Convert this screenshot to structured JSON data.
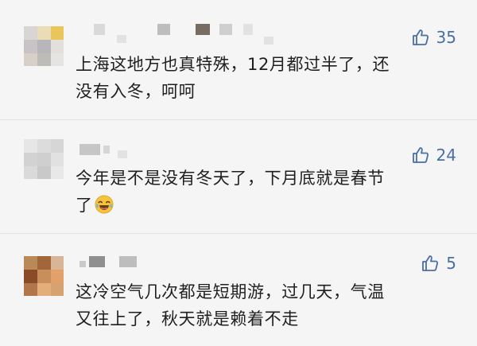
{
  "comments": [
    {
      "likes": "35",
      "text_line1": "上海这地方也真特殊，12月都过半了，还",
      "text_line2": "没有入冬，呵呵"
    },
    {
      "likes": "24",
      "text_line1": "今年是不是没有冬天了，下月底就是春节",
      "text_line2": "了",
      "emoji": "laughing-crying-emoji"
    },
    {
      "likes": "5",
      "text_line1": "这冷空气几次都是短期游，过几天，气温",
      "text_line2": "又往上了，秋天就是赖着不走"
    }
  ],
  "icons": {
    "like": "thumbs-up-icon"
  },
  "colors": {
    "accent": "#4a6fa5",
    "text": "#1f1f1f",
    "background": "#f5f5f5"
  }
}
